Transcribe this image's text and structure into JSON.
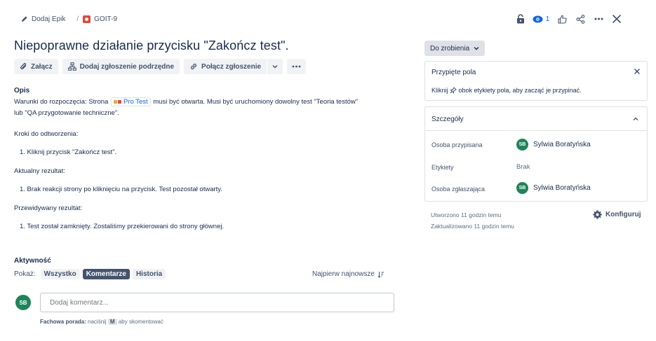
{
  "breadcrumb": {
    "add_epic": "Dodaj Epik",
    "separator": "/",
    "issue_key": "GOIT-9"
  },
  "topbar": {
    "watch_count": "1"
  },
  "issue": {
    "title": "Niepoprawne działanie przycisku \"Zakończ test\"."
  },
  "actions": {
    "attach": "Załącz",
    "add_child": "Dodaj zgłoszenie podrzędne",
    "link_issue": "Połącz zgłoszenie"
  },
  "description": {
    "heading": "Opis",
    "line1_before": "Warunki do rozpoczęcia: Strona ",
    "link_text": "Pro Test",
    "line1_after": " musi być otwarta. Musi być uruchomiony dowolny test \"Teoria testów\"",
    "line2": "lub \"QA przygotowanie techniczne\".",
    "steps_label": "Kroki do odtworzenia:",
    "step1": "1. Kliknij przycisk \"Zakończ test\".",
    "actual_label": "Aktualny rezultat:",
    "actual1": "1. Brak reakcji strony po kliknięciu na przycisk. Test pozostał otwarty.",
    "expected_label": "Przewidywany rezultat:",
    "expected1": "1. Test został zamknięty. Zostaliśmy przekierowani do strony głównej."
  },
  "activity": {
    "heading": "Aktywność",
    "show_label": "Pokaż:",
    "tabs": [
      "Wszystko",
      "Komentarze",
      "Historia"
    ],
    "sort_label": "Najpierw najnowsze",
    "avatar_initials": "SB",
    "comment_placeholder": "Dodaj komentarz...",
    "tip_bold": "Fachowa porada:",
    "tip_press": " naciśnij ",
    "tip_key": "M",
    "tip_rest": " aby skomentować"
  },
  "sidebar": {
    "status": "Do zrobienia",
    "pinned": {
      "title": "Przypięte pola",
      "hint_before": "Kliknij ",
      "hint_after": " obok etykiety pola, aby zacząć je przypinać."
    },
    "details": {
      "title": "Szczegóły",
      "assignee_label": "Osoba przypisana",
      "assignee_name": "Sylwia Boratyńska",
      "assignee_initials": "SB",
      "labels_label": "Etykiety",
      "labels_value": "Brak",
      "reporter_label": "Osoba zgłaszająca",
      "reporter_name": "Sylwia Boratyńska",
      "reporter_initials": "SB"
    },
    "created": "Utworzono 11 godzin temu",
    "updated": "Zaktualizowano 11 godzin temu",
    "configure": "Konfiguruj"
  },
  "colors": {
    "primary": "#0c66e4",
    "avatar": "#1f845a",
    "issue_red": "#e2483d"
  }
}
